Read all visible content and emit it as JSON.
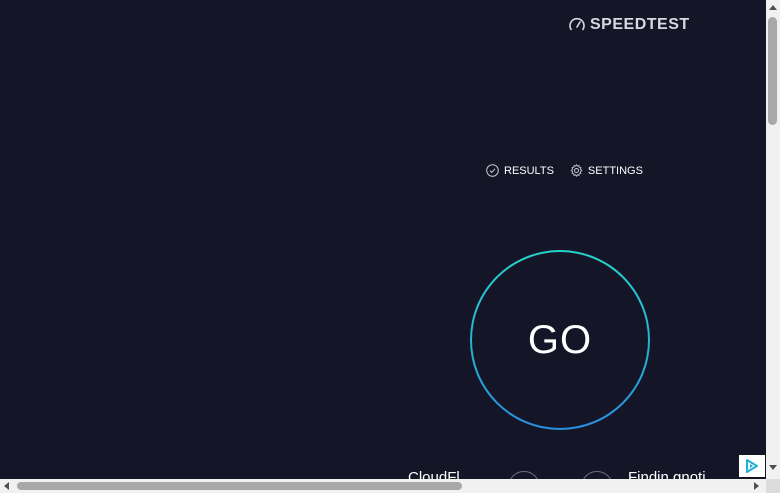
{
  "brand": {
    "name": "SPEEDTEST",
    "icon": "speedometer-icon"
  },
  "nav": {
    "results_label": "RESULTS",
    "settings_label": "SETTINGS"
  },
  "go_button": {
    "label": "GO"
  },
  "server": {
    "provider": "CloudFl",
    "location": "Findin gnoti"
  },
  "colors": {
    "background": "#141526",
    "ring_top": "#26d4c8",
    "ring_bottom": "#2a8fe0"
  }
}
